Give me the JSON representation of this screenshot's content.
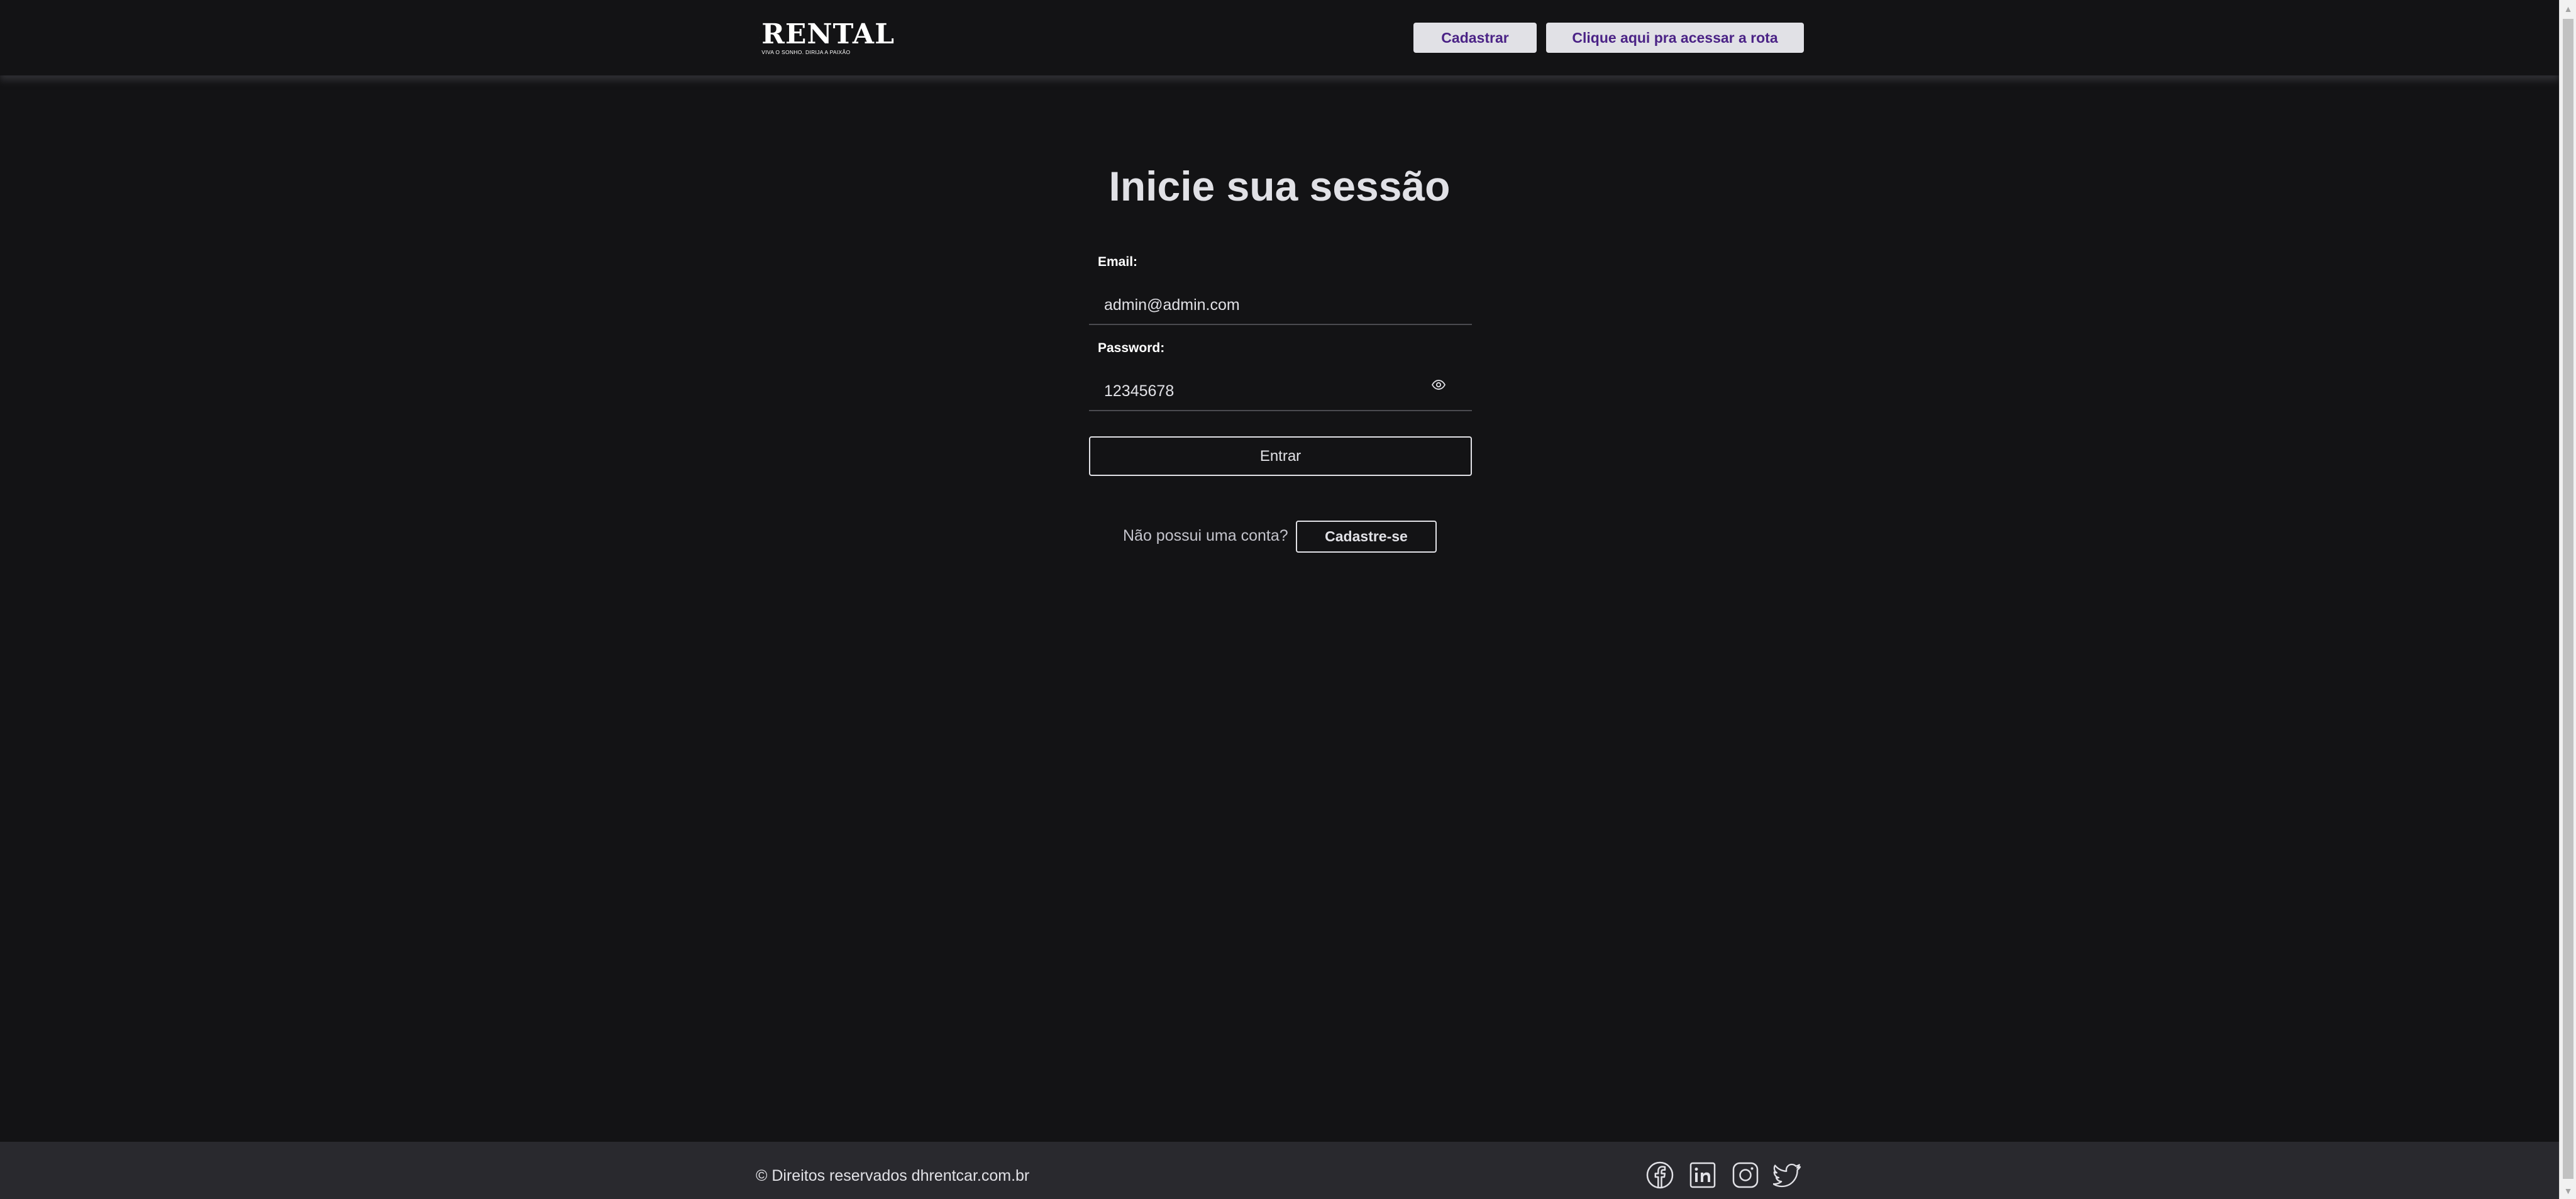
{
  "header": {
    "logo": {
      "wordmark": "RENTAL",
      "tagline": "VIVA O SONHO. DIRIJA A PAIXÃO"
    },
    "register_label": "Cadastrar",
    "route_label": "Clique aqui pra acessar a rota"
  },
  "login": {
    "title": "Inicie sua sessão",
    "email_label": "Email:",
    "email_value": "admin@admin.com",
    "password_label": "Password:",
    "password_value": "12345678",
    "submit_label": "Entrar",
    "no_account_text": "Não possui uma conta?",
    "signup_label": "Cadastre-se"
  },
  "footer": {
    "copyright": "© Direitos reservados dhrentcar.com.br",
    "social": [
      {
        "name": "facebook",
        "icon": "facebook-icon"
      },
      {
        "name": "linkedin",
        "icon": "linkedin-icon"
      },
      {
        "name": "instagram",
        "icon": "instagram-icon"
      },
      {
        "name": "twitter",
        "icon": "twitter-icon"
      }
    ]
  },
  "colors": {
    "background": "#131315",
    "footer_bg": "#29292e",
    "text": "#e1e1e6",
    "header_button_bg": "#e1e1e6",
    "header_button_text": "#4b2386"
  }
}
